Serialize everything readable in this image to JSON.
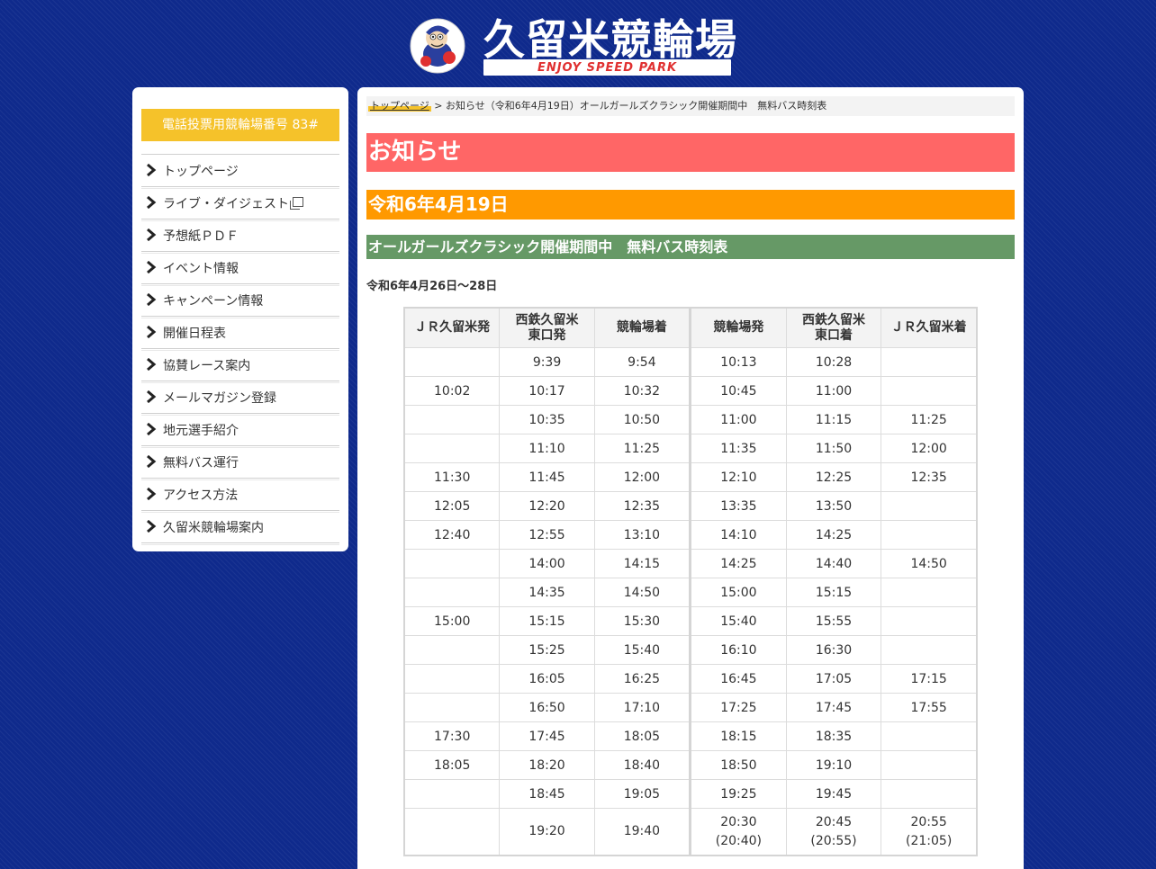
{
  "header": {
    "logo_title": "久留米競輪場",
    "logo_sub": "ENJOY SPEED PARK"
  },
  "sidebar": {
    "phone": "電話投票用競輪場番号 83#",
    "items": [
      {
        "label": "トップページ"
      },
      {
        "label": "ライブ・ダイジェスト"
      },
      {
        "label": "予想紙ＰＤＦ"
      },
      {
        "label": "イベント情報"
      },
      {
        "label": "キャンペーン情報"
      },
      {
        "label": "開催日程表"
      },
      {
        "label": "協賛レース案内"
      },
      {
        "label": "メールマガジン登録"
      },
      {
        "label": "地元選手紹介"
      },
      {
        "label": "無料バス運行"
      },
      {
        "label": "アクセス方法"
      },
      {
        "label": "久留米競輪場案内"
      }
    ]
  },
  "breadcrumb": {
    "home": "トップページ",
    "separator": " > ",
    "current": "お知らせ（令和6年4月19日）オールガールズクラシック開催期間中　無料バス時刻表"
  },
  "main": {
    "heading": "お知らせ",
    "date": "令和6年4月19日",
    "subtitle": "オールガールズクラシック開催期間中　無料バス時刻表",
    "period": "令和6年4月26日～28日"
  },
  "timetable": {
    "headers": [
      "ＪＲ久留米発",
      "西鉄久留米\n東口発",
      "競輪場着",
      "競輪場発",
      "西鉄久留米\n東口着",
      "ＪＲ久留米着"
    ],
    "rows": [
      [
        "",
        "9:39",
        "9:54",
        "10:13",
        "10:28",
        ""
      ],
      [
        "10:02",
        "10:17",
        "10:32",
        "10:45",
        "11:00",
        ""
      ],
      [
        "",
        "10:35",
        "10:50",
        "11:00",
        "11:15",
        "11:25"
      ],
      [
        "",
        "11:10",
        "11:25",
        "11:35",
        "11:50",
        "12:00"
      ],
      [
        "11:30",
        "11:45",
        "12:00",
        "12:10",
        "12:25",
        "12:35"
      ],
      [
        "12:05",
        "12:20",
        "12:35",
        "13:35",
        "13:50",
        ""
      ],
      [
        "12:40",
        "12:55",
        "13:10",
        "14:10",
        "14:25",
        ""
      ],
      [
        "",
        "14:00",
        "14:15",
        "14:25",
        "14:40",
        "14:50"
      ],
      [
        "",
        "14:35",
        "14:50",
        "15:00",
        "15:15",
        ""
      ],
      [
        "15:00",
        "15:15",
        "15:30",
        "15:40",
        "15:55",
        ""
      ],
      [
        "",
        "15:25",
        "15:40",
        "16:10",
        "16:30",
        ""
      ],
      [
        "",
        "16:05",
        "16:25",
        "16:45",
        "17:05",
        "17:15"
      ],
      [
        "",
        "16:50",
        "17:10",
        "17:25",
        "17:45",
        "17:55"
      ],
      [
        "17:30",
        "17:45",
        "18:05",
        "18:15",
        "18:35",
        ""
      ],
      [
        "18:05",
        "18:20",
        "18:40",
        "18:50",
        "19:10",
        ""
      ],
      [
        "",
        "18:45",
        "19:05",
        "19:25",
        "19:45",
        ""
      ],
      [
        "",
        "19:20",
        "19:40",
        "20:30\n(20:40)",
        "20:45\n(20:55)",
        "20:55\n(21:05)"
      ]
    ]
  },
  "colors": {
    "background": "#0f2a8c",
    "phone_box": "#f5c22a",
    "heading_notice": "#ff6666",
    "heading_date": "#ff9900",
    "heading_sub": "#669966"
  },
  "icons": {
    "nav_bullet": "chevron-right-icon",
    "external": "external-window-icon",
    "mascot": "mascot-logo"
  }
}
